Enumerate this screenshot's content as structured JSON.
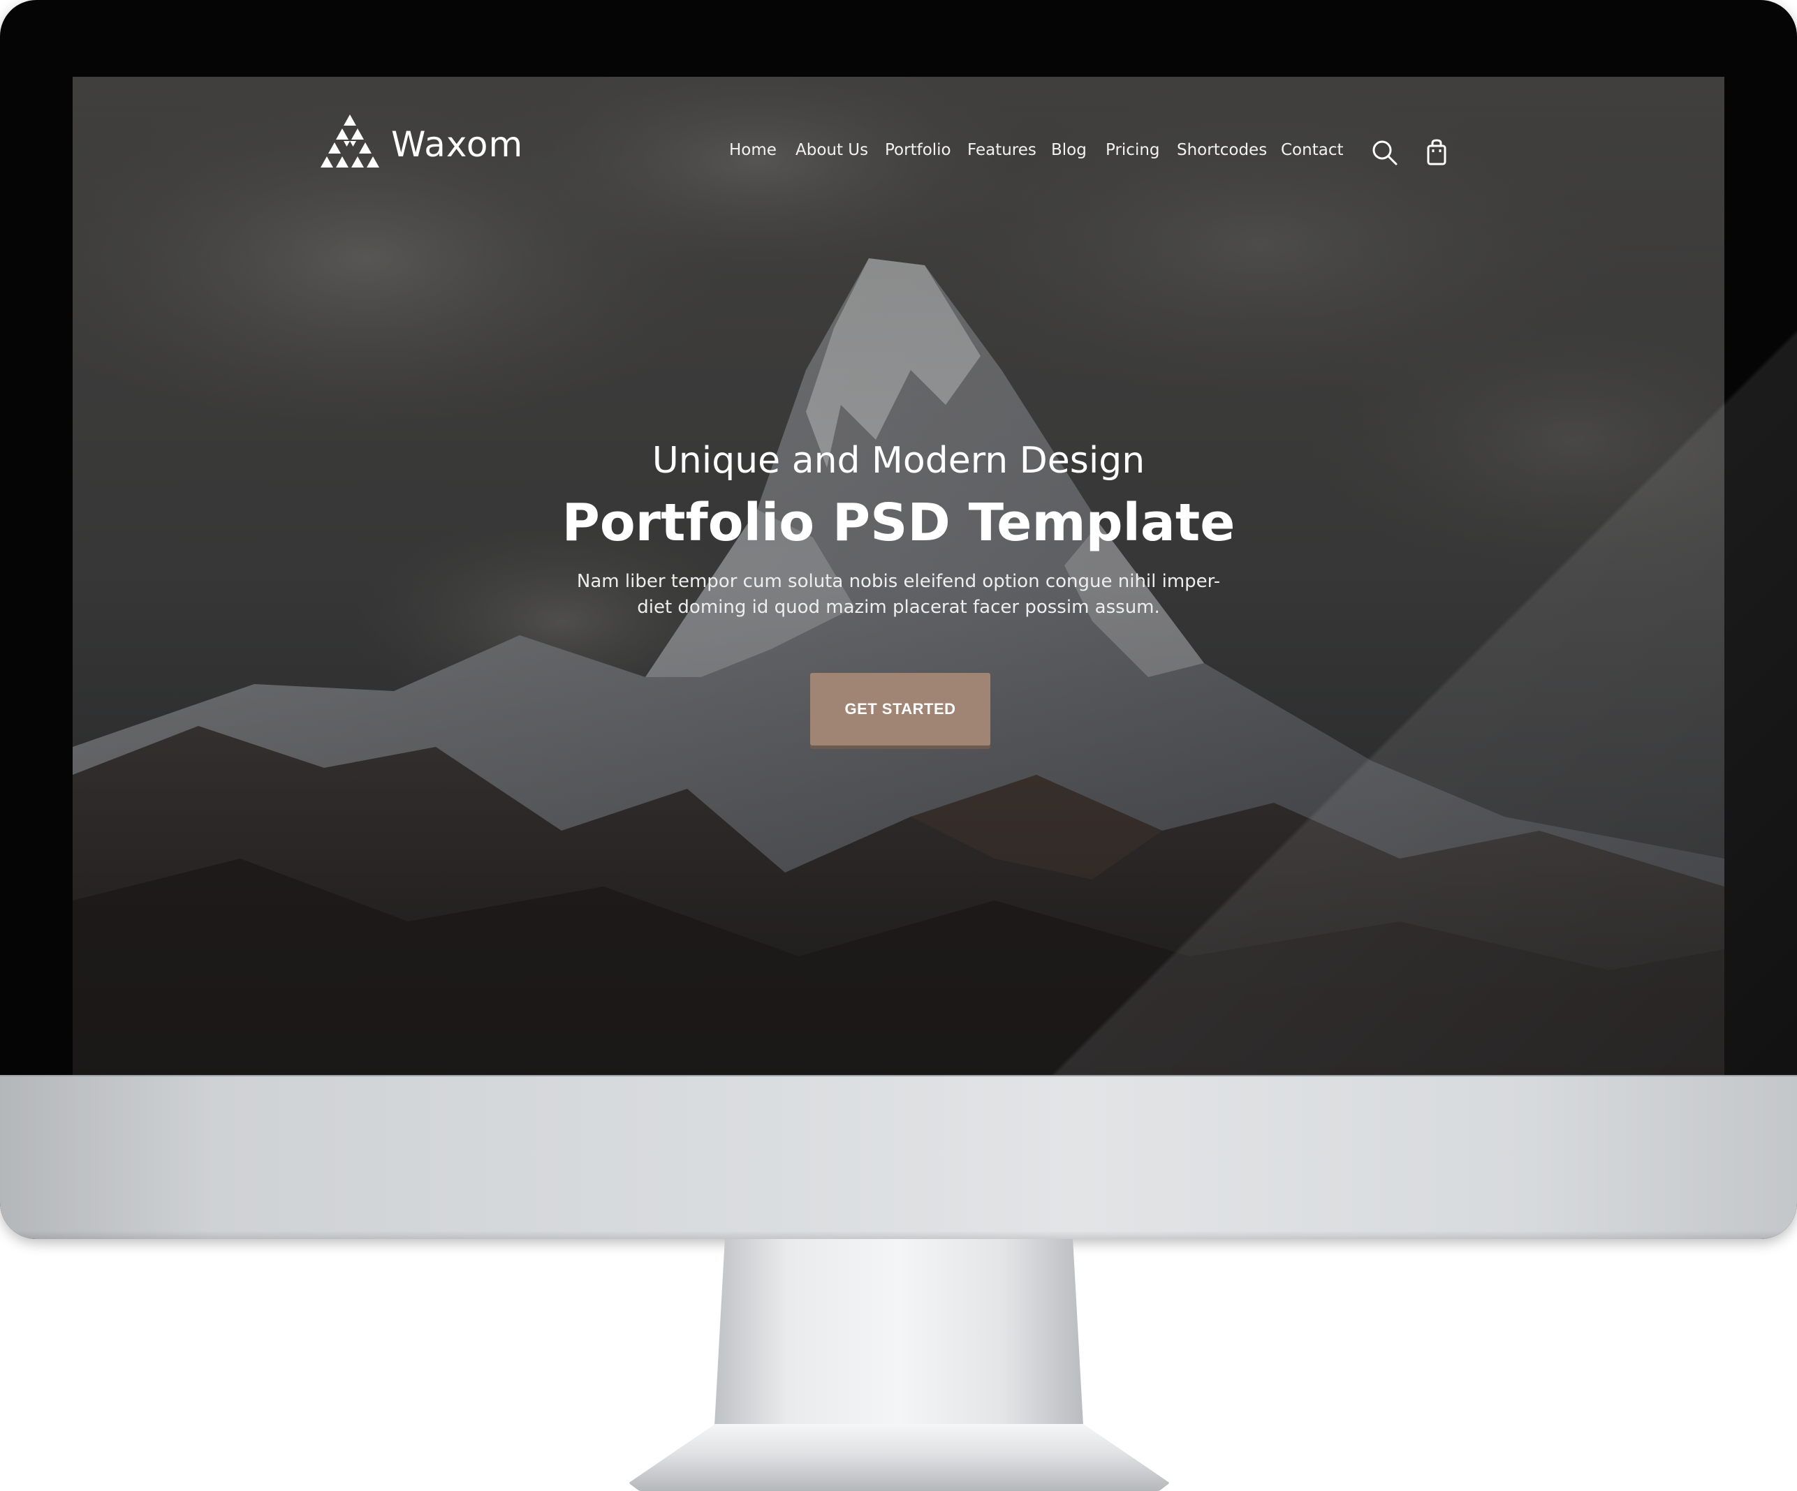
{
  "site": {
    "logo_text": "Waxom"
  },
  "nav": {
    "items": [
      {
        "label": "Home"
      },
      {
        "label": "About Us"
      },
      {
        "label": "Portfolio"
      },
      {
        "label": "Features"
      },
      {
        "label": "Blog"
      },
      {
        "label": "Pricing"
      },
      {
        "label": "Shortcodes"
      },
      {
        "label": "Contact"
      }
    ],
    "icons": [
      "search-icon",
      "shopping-bag-icon"
    ]
  },
  "hero": {
    "subtitle": "Unique and Modern Design",
    "title": "Portfolio PSD Template",
    "description_line1": "Nam liber tempor cum soluta nobis eleifend option congue nihil imper-",
    "description_line2": "diet doming id quod mazim placerat facer possim assum.",
    "cta_label": "GET STARTED"
  },
  "colors": {
    "accent": "#a08575",
    "text": "#ffffff",
    "bezel": "#050505",
    "chin": "#d9dcde"
  }
}
